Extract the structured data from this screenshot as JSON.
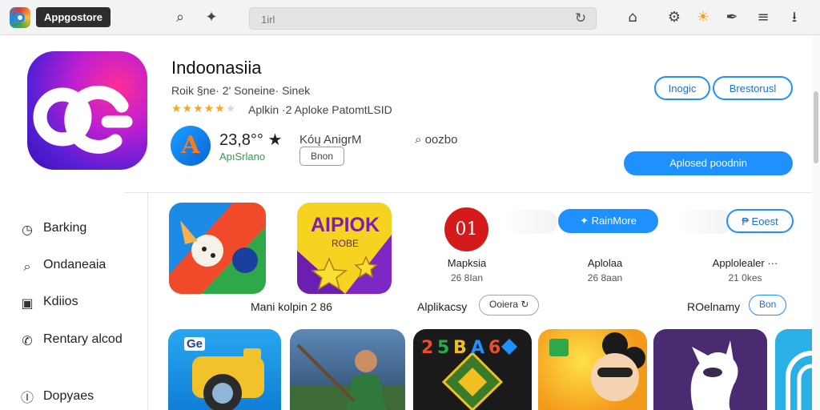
{
  "topbar": {
    "app_badge": "Appgostore",
    "url_value": "1irl",
    "icons": [
      "app-logo",
      "search-icon",
      "sparkle-icon",
      "reload-icon",
      "bell-icon",
      "settings-icon",
      "sun-icon",
      "paint-icon",
      "menu-icon",
      "download-icon"
    ]
  },
  "app": {
    "title": "Indoonasiia",
    "subtitle": "Roik §ne· 2' Soneine· Sinek",
    "rating_meta": "Aplkin ·2 Aploke PatomtLSID",
    "downloads": "23,8°° ★",
    "downloads_sub": "ApıSrlano",
    "age_label": "Kóų AnigrM",
    "age_button": "Bnon",
    "comments": "⌕ oozbo",
    "btn_install": "Inogic",
    "btn_restore": "Brestorusl",
    "btn_upload": "Aplosed poodnin",
    "stars_filled": 5,
    "stars_total": 6
  },
  "sidebar": {
    "items": [
      {
        "label": "Barking",
        "icon": "clock-icon"
      },
      {
        "label": "Ondaneaia",
        "icon": "search-icon"
      },
      {
        "label": "Kdiios",
        "icon": "image-icon"
      },
      {
        "label": "Rentary alcod",
        "icon": "phone-icon"
      },
      {
        "label": "Dopyaes",
        "icon": "download-icon"
      }
    ]
  },
  "featured": {
    "tile_text": "AIPIOK",
    "tile_sub": "ROBE",
    "badge_text": "01",
    "item1_name": "Mapksia",
    "item1_size": "26 8Ian",
    "item2_name": "Aplolaa",
    "item2_size": "26 8aan",
    "item3_name": "Applolealer ···",
    "item3_size": "21 0kes",
    "btn_more": "✦ RainMore",
    "btn_boost": "₱ Eoest",
    "caption_left": "Mani kolpin 2 86",
    "row_label": "Alplikacsy",
    "row_pill": "Ooiera ↻",
    "row_label2": "ROelnamy",
    "row_pill2": "Bon"
  },
  "games": {
    "tile1_text": "Ge"
  }
}
